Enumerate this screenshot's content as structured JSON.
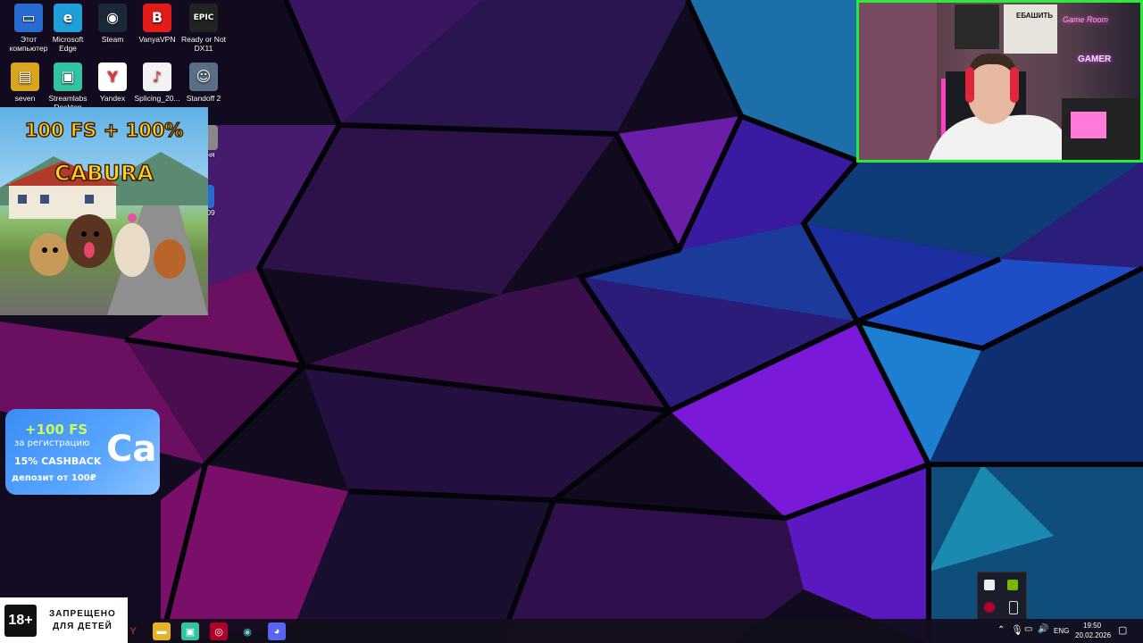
{
  "desktop": {
    "icons": [
      {
        "label": "Этот компьютер",
        "icon": "computer-icon",
        "glyph": "▭",
        "bg": "#2a6bd1"
      },
      {
        "label": "Microsoft Edge",
        "icon": "edge-icon",
        "glyph": "e",
        "bg": "#1f9ed8"
      },
      {
        "label": "Steam",
        "icon": "steam-icon",
        "glyph": "◉",
        "bg": "#1b2838"
      },
      {
        "label": "VanyaVPN",
        "icon": "vpn-icon",
        "glyph": "B",
        "bg": "#e21b1b"
      },
      {
        "label": "Ready or Not DX11",
        "icon": "epic-games-icon",
        "glyph": "EPIC",
        "bg": "#222222"
      },
      {
        "label": "seven",
        "icon": "archive-icon",
        "glyph": "▤",
        "bg": "#d9a520"
      },
      {
        "label": "Streamlabs Desktop",
        "icon": "streamlabs-icon",
        "glyph": "▣",
        "bg": "#31c3a2"
      },
      {
        "label": "Yandex",
        "icon": "yandex-icon",
        "glyph": "Y",
        "bg": "#ffffff"
      },
      {
        "label": "Splicing_20...",
        "icon": "audio-file-icon",
        "glyph": "♪",
        "bg": "#f2f2f2"
      },
      {
        "label": "Standoff 2",
        "icon": "standoff-icon",
        "glyph": "☺",
        "bg": "#5a6f86"
      }
    ],
    "partial_labels": [
      "ня",
      "09"
    ]
  },
  "promo_banner": {
    "headline": "100 FS + 100%",
    "brand": "CABURA"
  },
  "cashback_card": {
    "line1": "+100 FS",
    "line2": "за регистрацию",
    "line3": "15% CASHBACK",
    "line4": "депозит от 100₽",
    "logo": "Ca"
  },
  "webcam": {
    "neon1": "Game Room",
    "neon2": "GAMER",
    "poster": "ЕБАШИТЬ"
  },
  "age_warning": {
    "badge": "18+",
    "text_line1": "ЗАПРЕЩЕНО",
    "text_line2": "ДЛЯ ДЕТЕЙ"
  },
  "taskbar": {
    "apps": [
      {
        "name": "yandex-taskbar-icon",
        "glyph": "Y",
        "bg": "transparent",
        "color": "#e33"
      },
      {
        "name": "file-explorer-taskbar-icon",
        "glyph": "▬",
        "bg": "#e6b422",
        "color": "#fff"
      },
      {
        "name": "streamlabs-taskbar-icon",
        "glyph": "▣",
        "bg": "#31c3a2",
        "color": "#fff"
      },
      {
        "name": "obs-taskbar-icon",
        "glyph": "◎",
        "bg": "#b0002a",
        "color": "#fff"
      },
      {
        "name": "steam-taskbar-icon",
        "glyph": "◉",
        "bg": "transparent",
        "color": "#6cc"
      },
      {
        "name": "discord-taskbar-icon",
        "glyph": "◕",
        "bg": "#5865f2",
        "color": "#fff"
      }
    ],
    "language": "ENG",
    "time": "19:50",
    "date": "20.02.2026"
  }
}
